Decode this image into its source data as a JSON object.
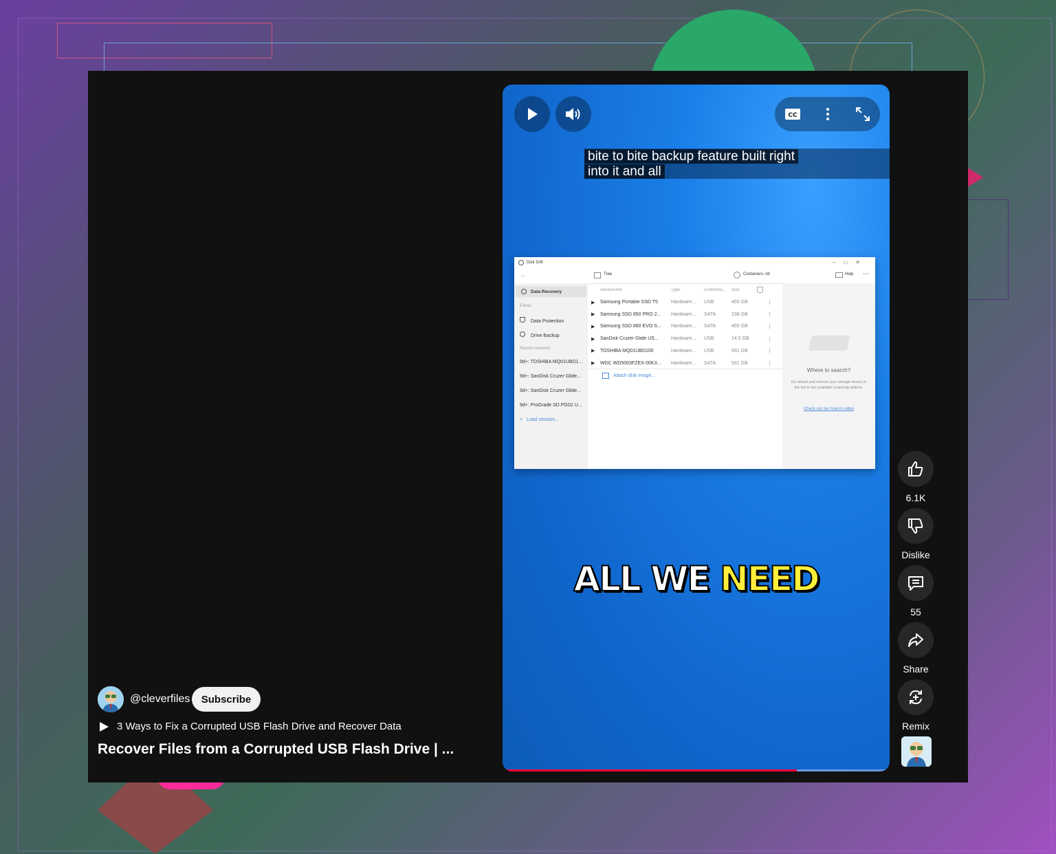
{
  "player": {
    "caption_lines": [
      "bite to bite backup feature built right",
      "into it and all"
    ],
    "overlay_text": {
      "white": "ALL WE",
      "highlight": "NEED"
    },
    "progress": 0.76,
    "icons": [
      "play-icon",
      "volume-icon",
      "cc-icon",
      "more-vert-icon",
      "fullscreen-icon"
    ]
  },
  "app_window": {
    "title": "Disk Drill",
    "toolbar": {
      "view": "Tree",
      "containers": "Containers: All",
      "help": "Help"
    },
    "sidebar": {
      "data_recovery": "Data Recovery",
      "extras": "Extras",
      "data_protection": "Data Protection",
      "drive_backup": "Drive Backup",
      "recent_sessions": "Recent sessions",
      "sessions": [
        "9d+: TOSHIBA MQ01UBD1...",
        "9d+: SanDisk Cruzer Glide...",
        "9d+: SanDisk Cruzer Glide...",
        "9d+: ProGrade SD PG02 U..."
      ],
      "load_session": "Load session..."
    },
    "columns": [
      "Device/Disk",
      "Type",
      "Connectio...",
      "Size"
    ],
    "rows": [
      {
        "name": "Samsung Portable SSD T5",
        "type": "Hardware...",
        "conn": "USB",
        "size": "465 GB"
      },
      {
        "name": "Samsung SSD 850 PRO 2...",
        "type": "Hardware...",
        "conn": "SATA",
        "size": "238 GB"
      },
      {
        "name": "Samsung SSD 860 EVO S...",
        "type": "Hardware...",
        "conn": "SATA",
        "size": "465 GB"
      },
      {
        "name": "SanDisk Cruzer Glide US...",
        "type": "Hardware...",
        "conn": "USB",
        "size": "14.5 GB"
      },
      {
        "name": "TOSHIBA MQ01UBD100",
        "type": "Hardware...",
        "conn": "USB",
        "size": "931 GB"
      },
      {
        "name": "WDC WD5003FZEX-00K3...",
        "type": "Hardware...",
        "conn": "SATA",
        "size": "931 GB"
      }
    ],
    "attach": "Attach disk image...",
    "right_panel": {
      "heading": "Where to search?",
      "body": "Go ahead and choose your storage device in the list to see available scanning options.",
      "link": "Check out our how-to video"
    }
  },
  "actions": {
    "like_count": "6.1K",
    "dislike_label": "Dislike",
    "comment_count": "55",
    "share_label": "Share",
    "remix_label": "Remix"
  },
  "meta": {
    "channel": "@cleverfiles",
    "subscribe_label": "Subscribe",
    "related_video": "3 Ways to Fix a Corrupted USB Flash Drive and Recover Data",
    "title": "Recover Files from a Corrupted USB Flash Drive | ..."
  },
  "colors": {
    "accent_red": "#ff0033",
    "highlight_yellow": "#ffef3a",
    "panel_bg": "#111111"
  }
}
